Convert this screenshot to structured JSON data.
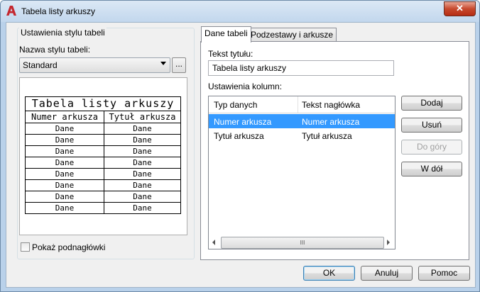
{
  "window": {
    "title": "Tabela listy arkuszy",
    "close_glyph": "✕"
  },
  "left": {
    "group_title": "Ustawienia stylu tabeli",
    "style_label": "Nazwa stylu tabeli:",
    "style_value": "Standard",
    "browse_label": "...",
    "preview": {
      "title": "Tabela listy arkuszy",
      "headers": [
        "Numer arkusza",
        "Tytuł arkusza"
      ],
      "rows": [
        [
          "Dane",
          "Dane"
        ],
        [
          "Dane",
          "Dane"
        ],
        [
          "Dane",
          "Dane"
        ],
        [
          "Dane",
          "Dane"
        ],
        [
          "Dane",
          "Dane"
        ],
        [
          "Dane",
          "Dane"
        ],
        [
          "Dane",
          "Dane"
        ],
        [
          "Dane",
          "Dane"
        ]
      ]
    },
    "subheaders_label": "Pokaż podnagłówki",
    "subheaders_checked": false
  },
  "tabs": [
    {
      "label": "Dane tabeli",
      "active": true
    },
    {
      "label": "Podzestawy i arkusze",
      "active": false
    }
  ],
  "panel": {
    "title_label": "Tekst tytułu:",
    "title_value": "Tabela listy arkuszy",
    "columns_label": "Ustawienia kolumn:",
    "columns_header": [
      "Typ danych",
      "Tekst nagłówka"
    ],
    "columns_rows": [
      {
        "type": "Numer arkusza",
        "header": "Numer arkusza",
        "selected": true
      },
      {
        "type": "Tytuł arkusza",
        "header": "Tytuł arkusza",
        "selected": false
      }
    ],
    "scroll_grip": "III"
  },
  "side_buttons": {
    "add": "Dodaj",
    "remove": "Usuń",
    "up": "Do góry",
    "down": "W dół"
  },
  "footer": {
    "ok": "OK",
    "cancel": "Anuluj",
    "help": "Pomoc"
  },
  "colors": {
    "selection": "#3399ff",
    "app_icon": "#c4262e"
  }
}
